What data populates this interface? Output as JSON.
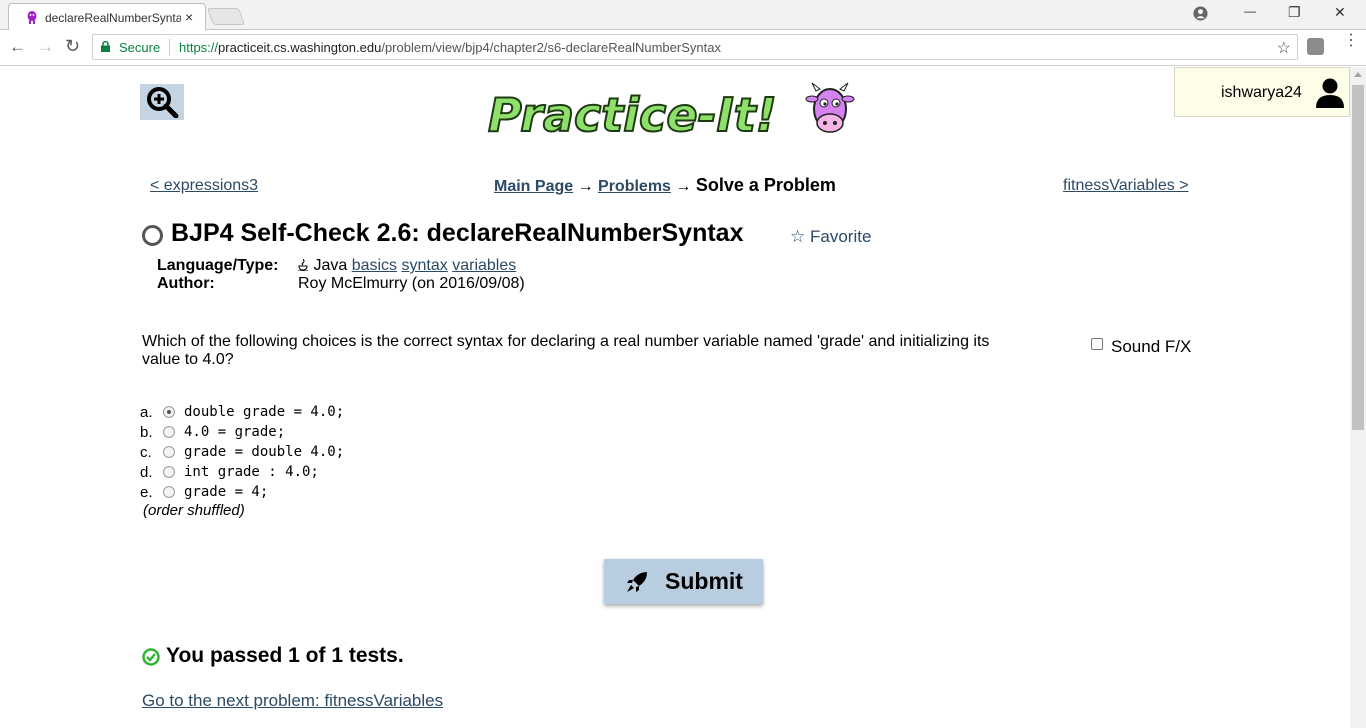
{
  "browser": {
    "tab_title": "declareRealNumberSyntax",
    "tab_close": "×",
    "security_label": "Secure",
    "url_scheme": "https://",
    "url_host": "practiceit.cs.washington.edu",
    "url_path": "/problem/view/bjp4/chapter2/s6-declareRealNumberSyntax",
    "back_glyph": "←",
    "forward_glyph": "→",
    "reload_glyph": "↻",
    "bookmark_glyph": "☆",
    "minimize_glyph": "—",
    "maximize_glyph": "❐",
    "close_glyph": "✕",
    "menu_glyph": "⋮",
    "icons": [
      "favicon-icon",
      "account-icon",
      "lock-icon",
      "extension-icon"
    ]
  },
  "header": {
    "logo_text": "Practice-It!",
    "username": "ishwarya24"
  },
  "nav": {
    "prev_link": "< expressions3",
    "next_link": "fitnessVariables >",
    "breadcrumb_main": "Main Page",
    "breadcrumb_arrow1": " → ",
    "breadcrumb_problems": "Problems",
    "breadcrumb_arrow2": " → ",
    "breadcrumb_current": "Solve a Problem"
  },
  "problem": {
    "title": "BJP4 Self-Check 2.6: declareRealNumberSyntax",
    "favorite_label": "Favorite",
    "favorite_glyph": "☆",
    "language_key": "Language/Type:",
    "language_icon": "java-cup-icon",
    "language_value": "Java",
    "tags": [
      "basics",
      "syntax",
      "variables"
    ],
    "author_key": "Author:",
    "author_value": "Roy McElmurry (on 2016/09/08)",
    "question": "Which of the following choices is the correct syntax for declaring a real number variable named 'grade' and initializing its value to 4.0?",
    "sound_label": "Sound F/X",
    "choices": [
      {
        "letter": "a.",
        "code": "double grade = 4.0;",
        "selected": true
      },
      {
        "letter": "b.",
        "code": "4.0 = grade;",
        "selected": false
      },
      {
        "letter": "c.",
        "code": "grade = double 4.0;",
        "selected": false
      },
      {
        "letter": "d.",
        "code": "int grade : 4.0;",
        "selected": false
      },
      {
        "letter": "e.",
        "code": "grade = 4;",
        "selected": false
      }
    ],
    "order_note": "(order shuffled)",
    "submit_label": "Submit"
  },
  "result": {
    "passed_text": "You passed 1 of 1 tests.",
    "next_problem_link": "Go to the next problem: fitnessVariables"
  },
  "colors": {
    "link": "#2b4a66",
    "submit_bg": "#b8cde0",
    "pass_green": "#2fb52f",
    "secure_green": "#0b8043"
  }
}
